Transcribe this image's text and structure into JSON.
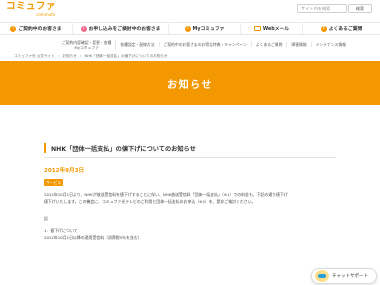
{
  "header": {
    "logo_main": "コミュファ",
    "logo_sub": "commufa",
    "search_placeholder": "サイト内を検索",
    "search_button": "検索"
  },
  "mainnav": [
    {
      "icon": "person-icon",
      "label": "ご契約中のお客さま",
      "color": "#f39800"
    },
    {
      "icon": "house-icon",
      "label": "お申し込みをご検討中のお客さま",
      "color": "#ed6d8f"
    },
    {
      "icon": "person-icon",
      "label": "Myコミュファ",
      "color": "#f39800"
    },
    {
      "icon": "mail-icon",
      "label": "Webメール",
      "color": "#f39800"
    },
    {
      "icon": "question-icon",
      "label": "よくあるご質問",
      "color": "#f39800"
    }
  ],
  "subnav": [
    "ご契約内容確認・変更・各種\nMyコミュファ",
    "各種設定・配線方法",
    "ご契約中のお客さまのお得な特典・キャンペーン",
    "よくあるご質問",
    "障害情報",
    "メンテナンス情報"
  ],
  "breadcrumb": [
    "コミュファ光 公式サイト",
    "お知らせ",
    "NHK「団体一括支払」の値下げについてのお知らせ"
  ],
  "banner_title": "お知らせ",
  "article": {
    "title": "NHK「団体一括支払」の値下げについてのお知らせ",
    "date": "2012年9月3日",
    "category": "サービス",
    "paragraphs": [
      "2012年10月1日より、NHKが放送受信料を値下げすることに伴い、NHK放送受信料「団体一括支払」（※1）での料金も、下記の通り値下げ",
      "値下げいたします。この機会に、コミュファ光テレビのご利用と団体一括支払のお申込（※2）を、是非ご検討ください。"
    ],
    "section_heading": "記",
    "list_item": "1．値下げについて",
    "list_detail": "2012年10月1日以降の適用受信料（消費税5％を含む）"
  },
  "chat": {
    "label": "チャットサポート"
  },
  "colors": {
    "accent": "#f39800",
    "pink": "#ed6d8f"
  }
}
